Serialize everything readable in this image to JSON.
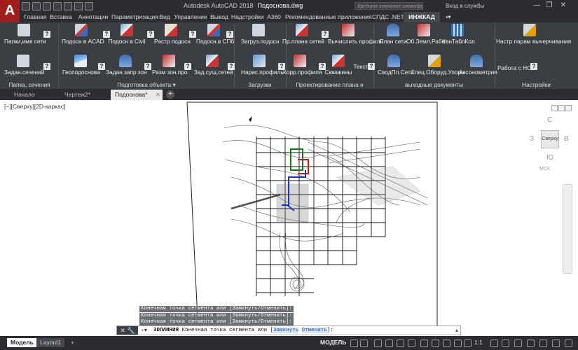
{
  "app": {
    "logo_letter": "A",
    "title": "Autodesk AutoCAD 2018",
    "filename": "Подоснова.dwg",
    "search_placeholder": "Введите ключевое слово/фразу",
    "login": "Вход в службы"
  },
  "ribbon_tabs": [
    "Главная",
    "Вставка",
    "Аннотации",
    "Параметризация",
    "Вид",
    "Управление",
    "Вывод",
    "Надстройки",
    "А360",
    "Рекомендованные приложения",
    "СПДС .NET",
    "ИНЖКАД"
  ],
  "ribbon_buttons": [
    "Папки,имя сети",
    "Задан.сечений",
    "Подосн в ACAD",
    "Подосн в Civil",
    "Растр подосн",
    "Подосн.в СПб",
    "Геоподоснова",
    "Задан.запр зон",
    "Разм зон.про",
    "Зад.сущ.сетей",
    "Загруз.подосн",
    "Нарис.профиль",
    "Пр.плана сетей",
    "Вычислить профиль",
    "Корр.профиля",
    "Скважины",
    "Текст",
    "План сети",
    "Об.Земл.Работ",
    "КанТаблКол",
    "СводПл.Сети",
    "Спец.Оборуд.Упоры",
    "Аксонометрия",
    "Настр парам вычерчивания",
    "Работа с НСИ"
  ],
  "ribbon_panels": [
    "Папка, сечения",
    "Подготовка объекта",
    "Загрузки",
    "Проектирование плана и профиля",
    "выходные документы",
    "Настройки"
  ],
  "doc_tabs": [
    "Начало",
    "Чертеж2*",
    "Подоснова*"
  ],
  "viewport": {
    "label": "[−][Сверху][2D-каркас]",
    "compass_n": "С",
    "compass_s": "Ю",
    "compass_w": "З",
    "compass_e": "В",
    "cube_face": "Сверху",
    "wcs": "МСК"
  },
  "command_history": [
    "Конечная точка сегмента или [Замкнуть/Отменить]:",
    "Конечная точка сегмента или [Замкнуть/Отменить]:",
    "Конечная точка сегмента или [Замкнуть/Отменить]:"
  ],
  "command_line": {
    "cmd": "3DПЛИНИЯ",
    "prompt": "Конечная точка сегмента или [",
    "opt1": "Замкнуть",
    "opt2": "Отменить",
    "tail": "]:"
  },
  "status": {
    "layout_tabs": [
      "Модель",
      "Layout1"
    ],
    "model": "МОДЕЛЬ",
    "scale": "1:1"
  },
  "colors": {
    "accent": "#a31d1d",
    "ribbon_bg": "#3b3f44",
    "title_bg": "#2b2d31"
  }
}
